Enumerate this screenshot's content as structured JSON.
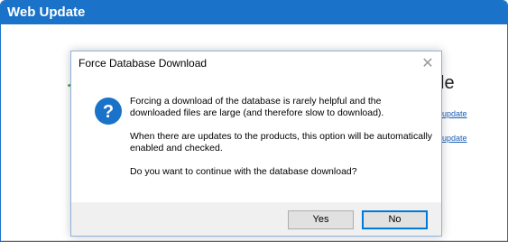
{
  "window": {
    "title": "Web Update",
    "heading_fragment": "le",
    "links": [
      "update",
      "update"
    ]
  },
  "dialog": {
    "title": "Force Database Download",
    "close_glyph": "✕",
    "messages": [
      "Forcing a download of the database is rarely helpful and the downloaded files are large (and therefore slow to download).",
      "When there are updates to the products, this option will be automatically enabled and checked.",
      "Do you want to continue with the database download?"
    ],
    "icon": "question-icon",
    "buttons": {
      "yes": "Yes",
      "no": "No"
    },
    "default_button": "No"
  },
  "colors": {
    "titlebar": "#1a73c9",
    "icon": "#1a73c9",
    "default_button_border": "#0078d7",
    "footer": "#f0f0f0"
  }
}
